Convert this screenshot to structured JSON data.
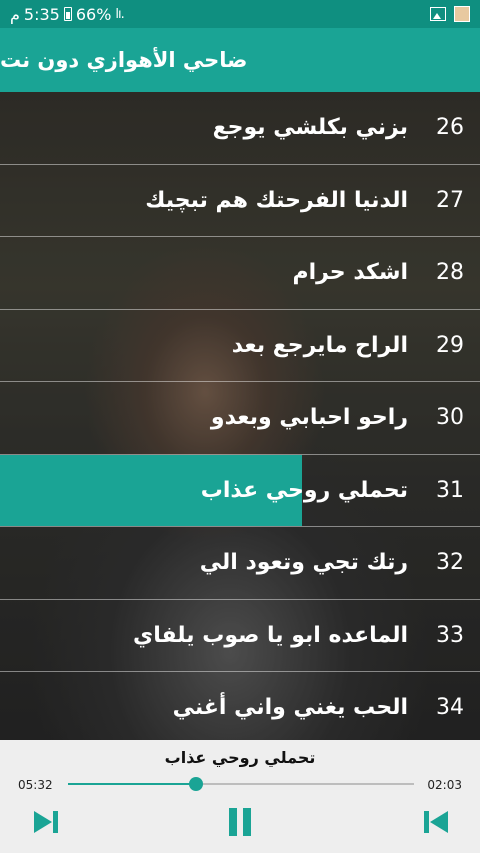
{
  "status_bar": {
    "time": "5:35",
    "battery": "66%",
    "carrier_glyph": "م"
  },
  "header": {
    "title": "ضاحي الأهوازي دون نت"
  },
  "songs": [
    {
      "number": "26",
      "title": "بزني بكلشي يوجع"
    },
    {
      "number": "27",
      "title": "الدنيا الفرحتك هم تبچيك"
    },
    {
      "number": "28",
      "title": "اشكد حرام"
    },
    {
      "number": "29",
      "title": "الراح مايرجع بعد"
    },
    {
      "number": "30",
      "title": "راحو احبابي وبعدو"
    },
    {
      "number": "31",
      "title": "تحملي روحي عذاب",
      "active": true
    },
    {
      "number": "32",
      "title": "رتك تجي وتعود الي"
    },
    {
      "number": "33",
      "title": "الماعده ابو يا صوب يلفاي"
    },
    {
      "number": "34",
      "title": "الحب يغني واني أغني"
    }
  ],
  "player": {
    "now_playing": "تحملي روحي عذاب",
    "total_time": "05:32",
    "elapsed_time": "02:03",
    "progress": 0.37,
    "accent_color": "#1aa495",
    "controls": {
      "next_icon": "skip-next-icon",
      "pause_icon": "pause-icon",
      "prev_icon": "skip-previous-icon"
    }
  }
}
